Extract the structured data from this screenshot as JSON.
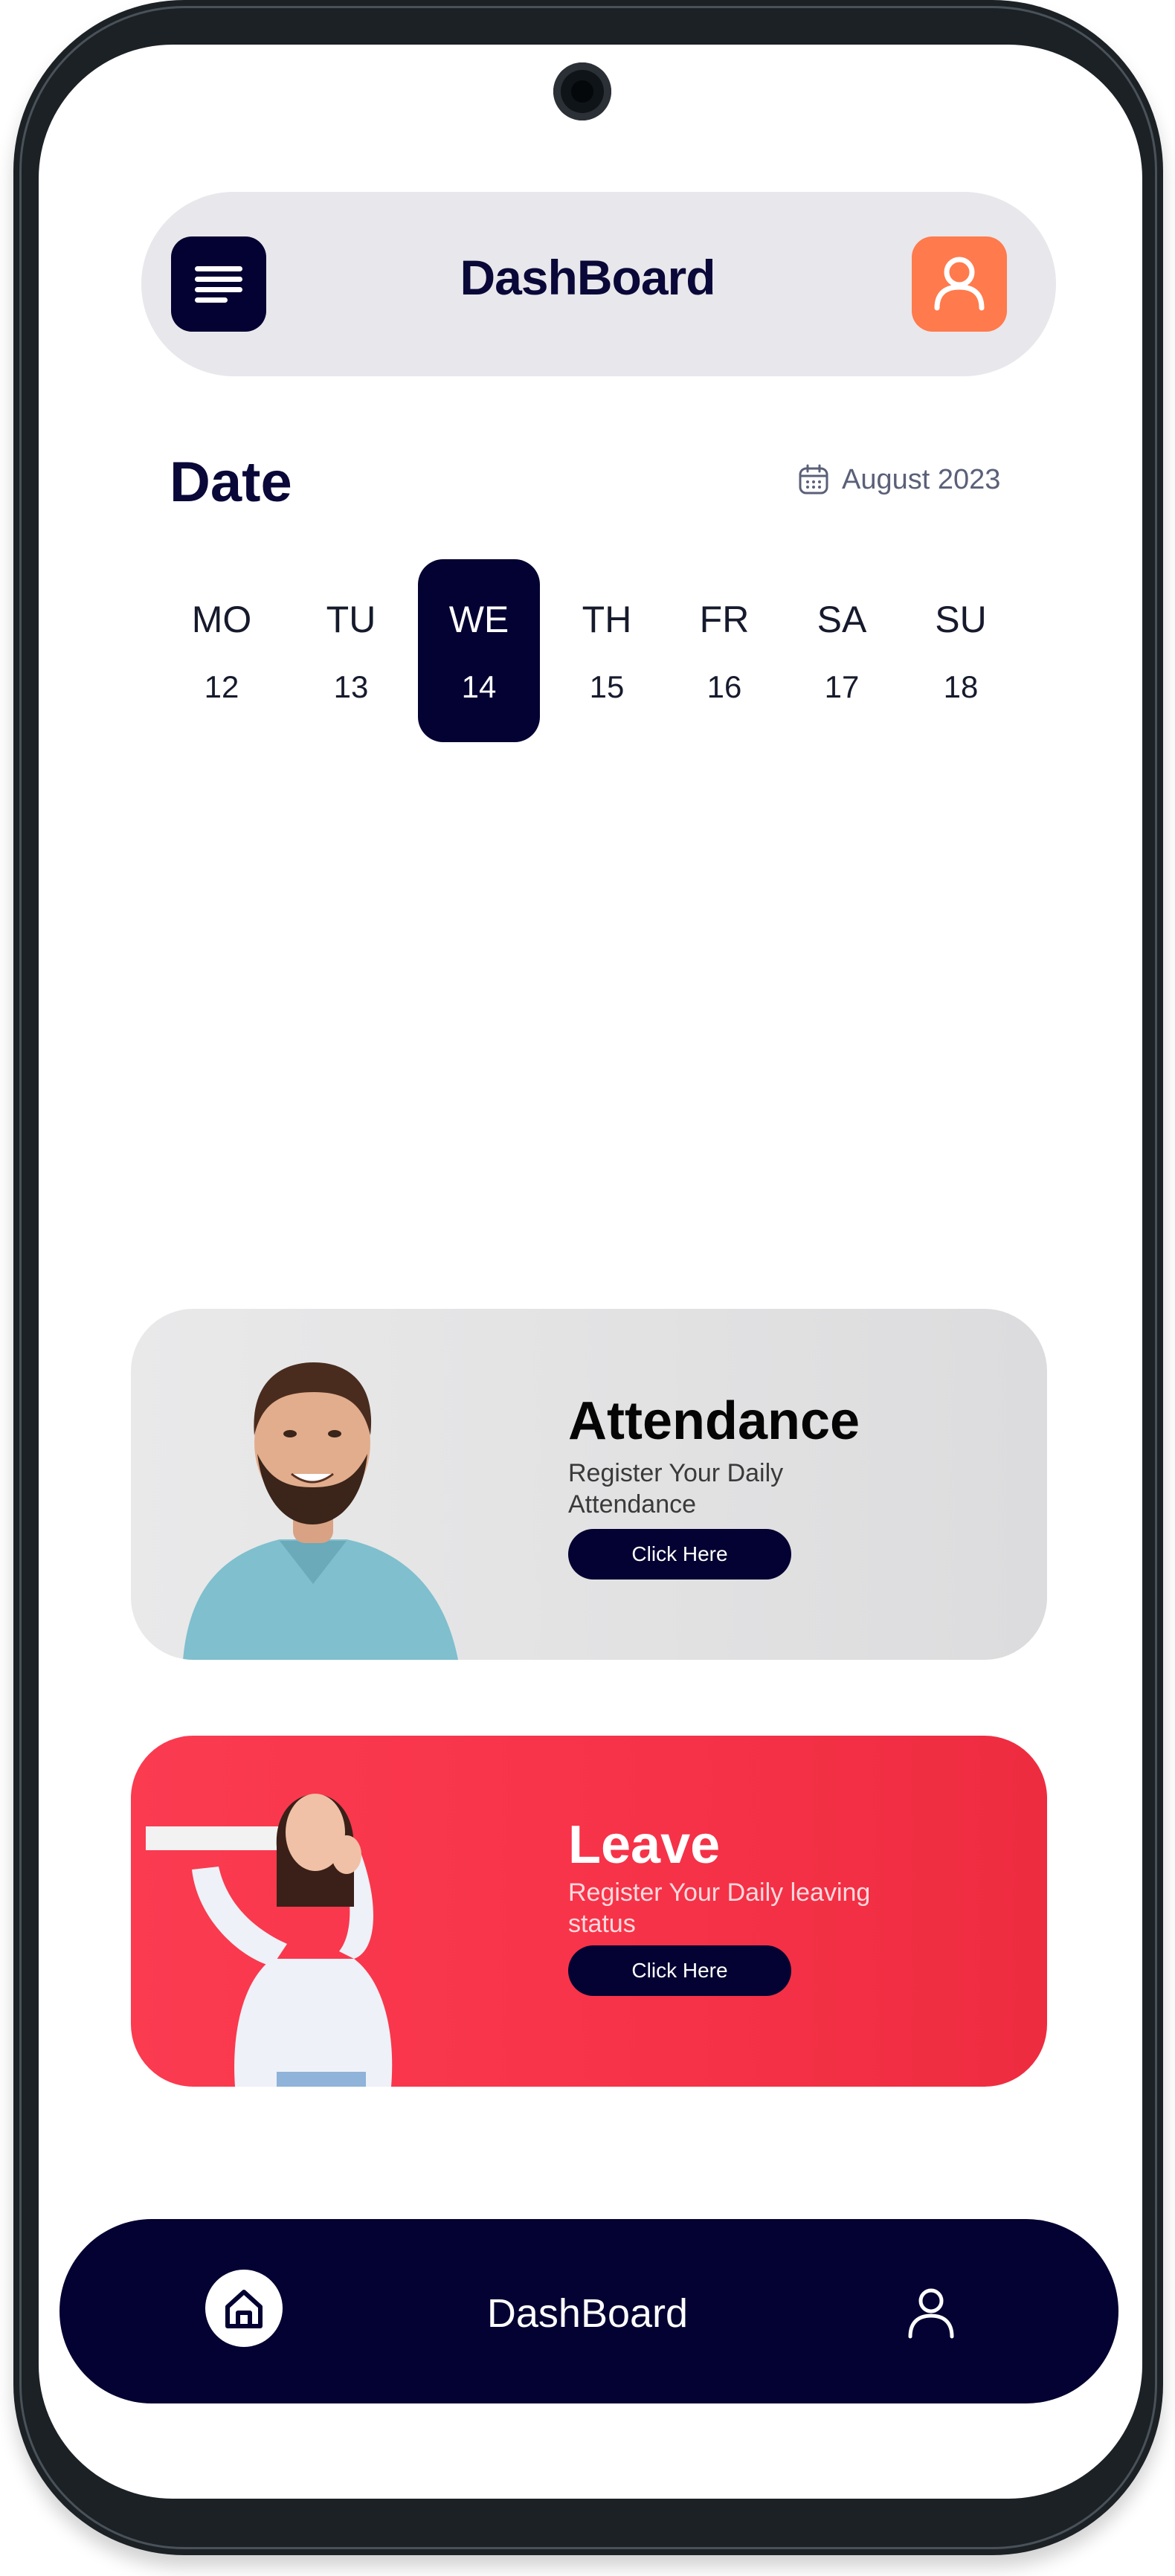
{
  "header": {
    "title": "DashBoard",
    "menu_icon": "menu-lines-icon",
    "profile_icon": "user-icon"
  },
  "date_section": {
    "heading": "Date",
    "month": "August 2023",
    "calendar_icon": "calendar-icon",
    "days": [
      {
        "name": "MO",
        "num": "12"
      },
      {
        "name": "TU",
        "num": "13"
      },
      {
        "name": "WE",
        "num": "14"
      },
      {
        "name": "TH",
        "num": "15"
      },
      {
        "name": "FR",
        "num": "16"
      },
      {
        "name": "SA",
        "num": "17"
      },
      {
        "name": "SU",
        "num": "18"
      }
    ],
    "selected_day": "WE"
  },
  "cards": {
    "attendance": {
      "title": "Attendance",
      "subtitle": "Register Your Daily Attendance",
      "button": "Click Here"
    },
    "leave": {
      "title": "Leave",
      "subtitle": "Register Your Daily leaving status",
      "button": "Click Here"
    }
  },
  "bottom_nav": {
    "title": "DashBoard",
    "home_icon": "home-icon",
    "profile_icon": "user-icon"
  },
  "colors": {
    "navy": "#040232",
    "accent_orange": "#ff7a4c",
    "leave_red": "#f8344a",
    "header_bg": "#e8e7eb"
  }
}
